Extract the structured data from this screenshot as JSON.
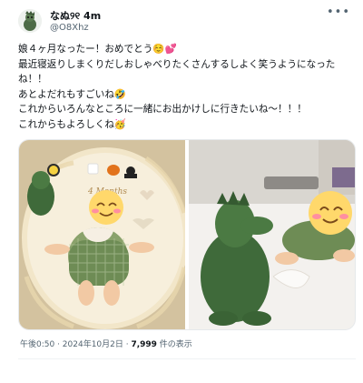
{
  "post": {
    "display_name": "なぬ୨୧ 4m",
    "handle": "@O8Xhz",
    "more_label": "•••",
    "lines": [
      "娘４ヶ月なったー！おめでとう☺️💕",
      "最近寝返りしまくりだしおしゃべりたくさんするしよく笑うようになった",
      "ね！！",
      "あとよだれもすごいね🤣",
      "これからいろんなところに一緒にお出かけしに行きたいね〜！！！",
      "これからもよろしくね🥳"
    ],
    "photo_left_letterboard": "4 Months",
    "timestamp": "午後0:50 · 2024年10月2日 · ",
    "views_count": "7,999",
    "views_label": " 件の表示"
  },
  "colors": {
    "text": "#0f1419",
    "secondary": "#536471",
    "divider": "#eff3f4",
    "sticker_face": "#ffd86b",
    "sticker_blush": "#ff8fa0"
  }
}
